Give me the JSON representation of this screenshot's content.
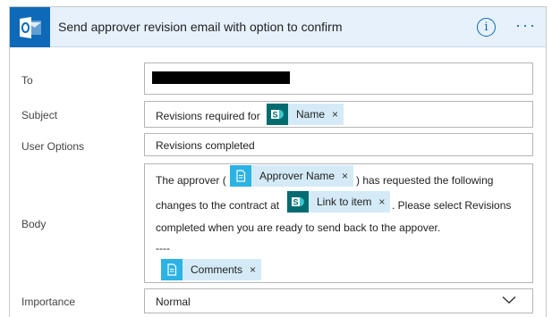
{
  "header": {
    "title": "Send approver revision email with option to confirm",
    "info_glyph": "i",
    "more_glyph": "···",
    "app_icon": "outlook-icon",
    "brand_color": "#0e6ab8"
  },
  "fields": {
    "to": {
      "label": "To",
      "value_redacted": true
    },
    "subject": {
      "label": "Subject",
      "text": "Revisions required for",
      "token": {
        "label": "Name",
        "icon": "sharepoint-icon"
      }
    },
    "user_options": {
      "label": "User Options",
      "value": "Revisions completed"
    },
    "body": {
      "label": "Body",
      "part1": "The approver (",
      "token1": {
        "label": "Approver Name",
        "icon": "flow-token-icon"
      },
      "part2": ") has requested the following",
      "part3": "changes to the contract at",
      "token2": {
        "label": "Link to item",
        "icon": "sharepoint-icon"
      },
      "part4": ". Please select Revisions",
      "part5": "completed when you are ready to send back to the appover.",
      "separator": "----",
      "token3": {
        "label": "Comments",
        "icon": "flow-token-icon"
      }
    },
    "importance": {
      "label": "Importance",
      "value": "Normal"
    }
  },
  "token_close_glyph": "×"
}
